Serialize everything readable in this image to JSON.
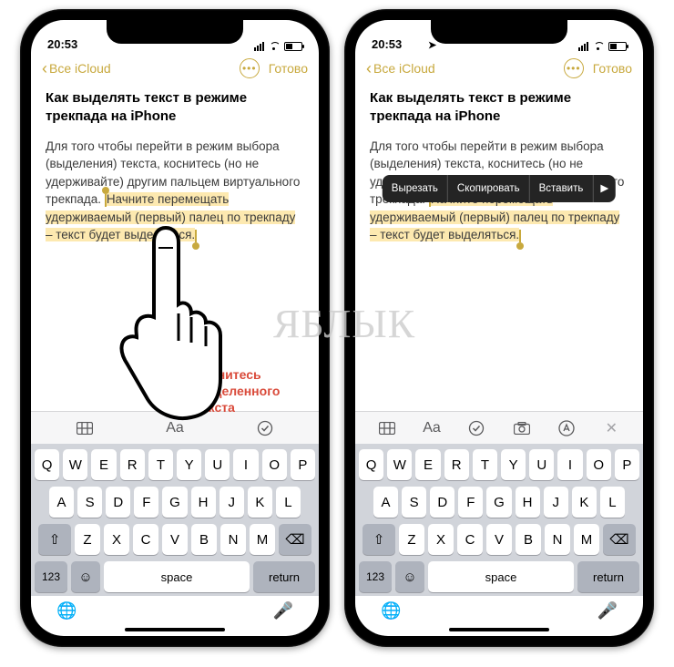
{
  "status": {
    "time": "20:53",
    "time_loc": "20:53"
  },
  "nav": {
    "back": "Все iCloud",
    "done": "Готово"
  },
  "note": {
    "title": "Как выделять текст в режиме трекпада на iPhone",
    "body_pre": "Для того чтобы перейти в режим выбора (выделения) текста, коснитесь (но не удерживайте) другим пальцем виртуального трекпада. ",
    "body_hl": "Начните перемещать удерживаемый (первый) палец по трекпаду – текст будет выделяться."
  },
  "hint": {
    "l1": "Коснитесь",
    "l2": "выделенного",
    "l3": "текста"
  },
  "menu": {
    "cut": "Вырезать",
    "copy": "Скопировать",
    "paste": "Вставить",
    "more": "▶"
  },
  "toolbar": {
    "aa": "Aa",
    "check": "✓",
    "cam": "camera",
    "pen": "pen",
    "x": "✕"
  },
  "keys": {
    "r1": [
      "Q",
      "W",
      "E",
      "R",
      "T",
      "Y",
      "U",
      "I",
      "O",
      "P"
    ],
    "r2": [
      "A",
      "S",
      "D",
      "F",
      "G",
      "H",
      "J",
      "K",
      "L"
    ],
    "r3": [
      "Z",
      "X",
      "C",
      "V",
      "B",
      "N",
      "M"
    ],
    "num": "123",
    "space": "space",
    "ret": "return"
  },
  "watermark": "ЯБЛЫК"
}
